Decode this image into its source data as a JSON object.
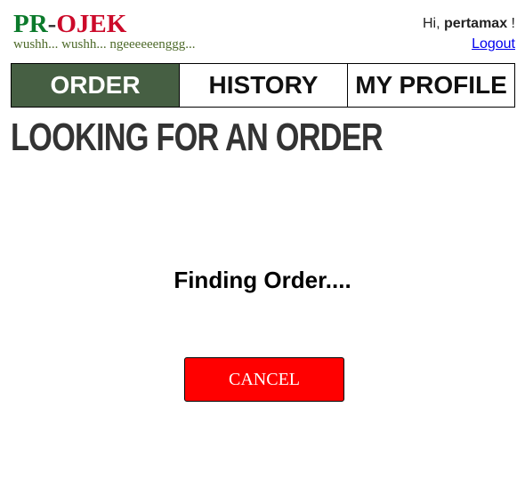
{
  "header": {
    "logo": {
      "part1": "PR",
      "separator": "-",
      "part2": "OJEK"
    },
    "tagline": "wushh... wushh... ngeeeeeenggg...",
    "greeting_prefix": "Hi, ",
    "username": "pertamax",
    "greeting_suffix": " !",
    "logout_label": "Logout"
  },
  "nav": {
    "tabs": [
      {
        "label": "ORDER",
        "active": true
      },
      {
        "label": "HISTORY",
        "active": false
      },
      {
        "label": "MY PROFILE",
        "active": false
      }
    ]
  },
  "main": {
    "title": "LOOKING FOR AN ORDER",
    "status_text": "Finding Order....",
    "cancel_label": "CANCEL"
  },
  "colors": {
    "logo_pr": "#0b7a2b",
    "logo_ojek": "#cc0a2a",
    "active_tab": "#465f43",
    "cancel_button": "#ff0000",
    "link": "#0000ee"
  }
}
